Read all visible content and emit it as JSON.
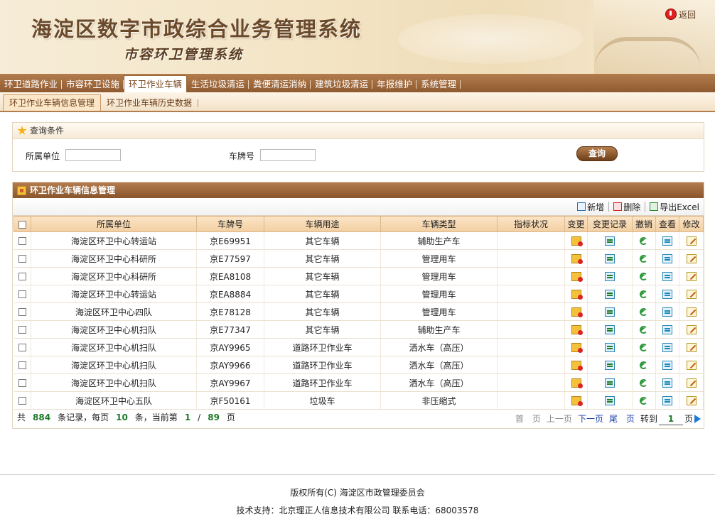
{
  "header": {
    "title": "海淀区数字市政综合业务管理系统",
    "subtitle": "市容环卫管理系统",
    "logout_label": "返回"
  },
  "nav": {
    "tabs": [
      {
        "label": "环卫道路作业"
      },
      {
        "label": "市容环卫设施"
      },
      {
        "label": "环卫作业车辆",
        "active": true
      },
      {
        "label": "生活垃圾清运"
      },
      {
        "label": "粪便清运消纳"
      },
      {
        "label": "建筑垃圾清运"
      },
      {
        "label": "年报维护"
      },
      {
        "label": "系统管理"
      }
    ]
  },
  "subnav": {
    "tabs": [
      {
        "label": "环卫作业车辆信息管理",
        "active": true
      },
      {
        "label": "环卫作业车辆历史数据"
      }
    ]
  },
  "query": {
    "title": "查询条件",
    "unit_label": "所属单位",
    "unit_value": "",
    "plate_label": "车牌号",
    "plate_value": "",
    "search_button": "查询"
  },
  "panel": {
    "title": "环卫作业车辆信息管理",
    "toolbar": {
      "add": "新增",
      "delete": "删除",
      "export": "导出Excel"
    },
    "columns": [
      "所属单位",
      "车牌号",
      "车辆用途",
      "车辆类型",
      "指标状况",
      "变更",
      "变更记录",
      "撤销",
      "查看",
      "修改"
    ],
    "rows": [
      {
        "unit": "海淀区环卫中心转运站",
        "plate": "京E69951",
        "usage": "其它车辆",
        "type": "辅助生产车",
        "status": ""
      },
      {
        "unit": "海淀区环卫中心科研所",
        "plate": "京E77597",
        "usage": "其它车辆",
        "type": "管理用车",
        "status": ""
      },
      {
        "unit": "海淀区环卫中心科研所",
        "plate": "京EA8108",
        "usage": "其它车辆",
        "type": "管理用车",
        "status": ""
      },
      {
        "unit": "海淀区环卫中心转运站",
        "plate": "京EA8884",
        "usage": "其它车辆",
        "type": "管理用车",
        "status": ""
      },
      {
        "unit": "海淀区环卫中心四队",
        "plate": "京E78128",
        "usage": "其它车辆",
        "type": "管理用车",
        "status": ""
      },
      {
        "unit": "海淀区环卫中心机扫队",
        "plate": "京E77347",
        "usage": "其它车辆",
        "type": "辅助生产车",
        "status": ""
      },
      {
        "unit": "海淀区环卫中心机扫队",
        "plate": "京AY9965",
        "usage": "道路环卫作业车",
        "type": "洒水车（高压）",
        "status": ""
      },
      {
        "unit": "海淀区环卫中心机扫队",
        "plate": "京AY9966",
        "usage": "道路环卫作业车",
        "type": "洒水车（高压）",
        "status": ""
      },
      {
        "unit": "海淀区环卫中心机扫队",
        "plate": "京AY9967",
        "usage": "道路环卫作业车",
        "type": "洒水车（高压）",
        "status": ""
      },
      {
        "unit": "海淀区环卫中心五队",
        "plate": "京F50161",
        "usage": "垃圾车",
        "type": "非压缩式",
        "status": ""
      }
    ],
    "icons": {
      "change": "change-icon",
      "history": "history-icon",
      "revoke": "revoke-icon",
      "view": "view-icon",
      "edit": "edit-icon"
    }
  },
  "pager": {
    "total_prefix": "共",
    "total_records": "884",
    "records_per_page_label": "条记录，每页",
    "page_size": "10",
    "current_label": "条，当前第",
    "current_page": "1",
    "slash": "/",
    "total_pages": "89",
    "pages_suffix": "页",
    "first": "首　页",
    "prev": "上一页",
    "next": "下一页",
    "last": "尾　页",
    "goto_label": "转到",
    "goto_value": "1",
    "goto_suffix": "页"
  },
  "footer": {
    "copyright": "版权所有(C) 海淀区市政管理委员会",
    "support": "技术支持：北京理正人信息技术有限公司 联系电话：68003578"
  }
}
